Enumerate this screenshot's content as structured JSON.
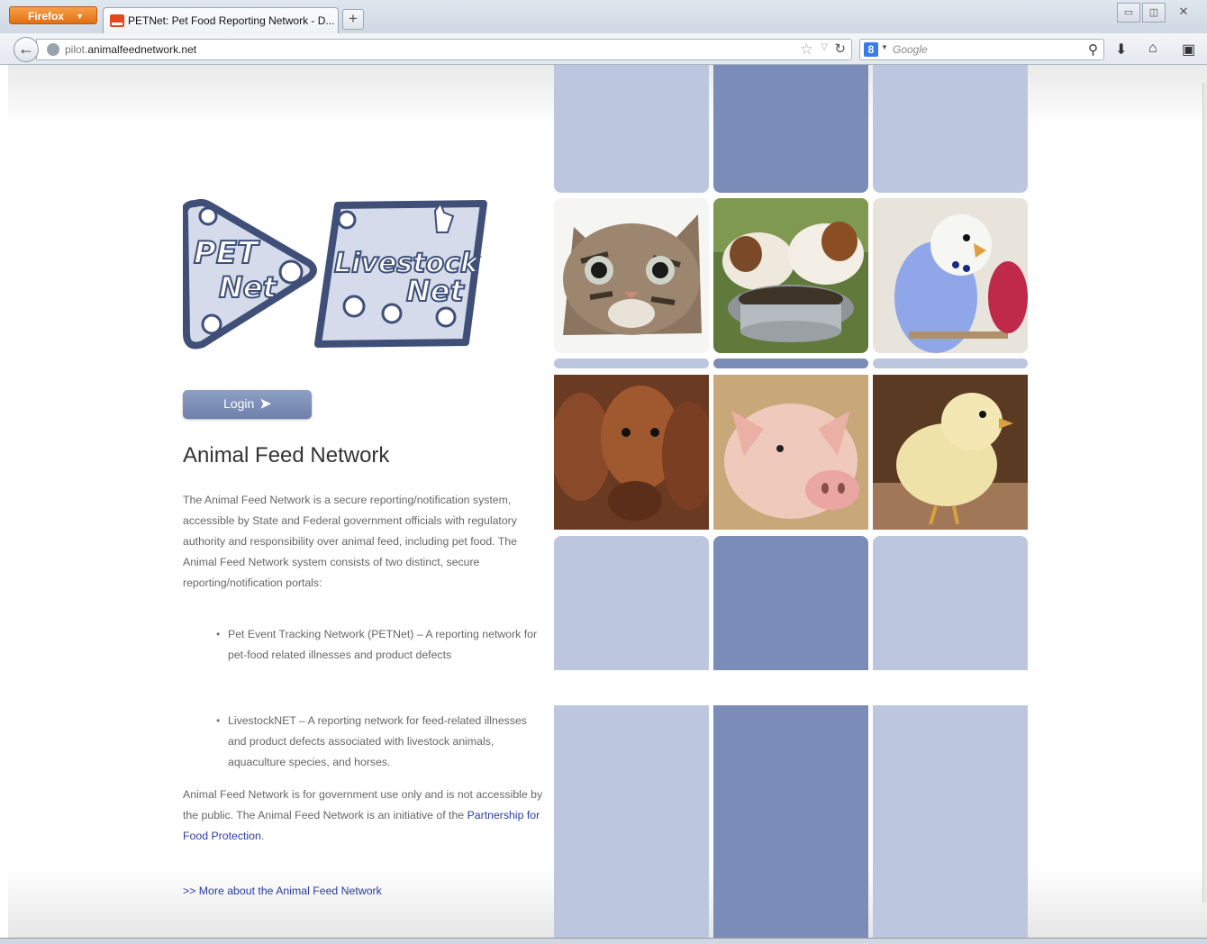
{
  "browser": {
    "menu_label": "Firefox",
    "tab_title": "PETNet: Pet Food Reporting Network - D...",
    "url_prefix": "pilot.",
    "url_domain": "animalfeednetwork.net",
    "search_placeholder": "Google"
  },
  "page": {
    "logo_left_line1": "PET",
    "logo_left_line2": "Net",
    "logo_right_line1": "Livestock",
    "logo_right_line2": "Net",
    "login_label": "Login",
    "heading": "Animal Feed Network",
    "intro": "The Animal Feed Network is a secure reporting/notification system, accessible by State and Federal government officials with regulatory authority and responsibility over animal feed, including pet food. The Animal Feed Network system consists of two distinct, secure reporting/notification portals:",
    "bullets": [
      "Pet Event Tracking Network (PETNet) – A reporting network for pet-food related illnesses and product defects",
      "LivestockNET – A reporting network for feed-related illnesses and product defects associated with livestock animals, aquaculture species, and horses."
    ],
    "footer_text_1": "Animal Feed Network is for government use only and is not accessible by the public.  The Animal Feed Network is an initiative of the ",
    "footer_link": "Partnership for Food Protection",
    "footer_text_2": ".",
    "more_link": ">> More about the Animal Feed Network"
  },
  "colors": {
    "tile_light": "#bcc7df",
    "tile_dark": "#7a8cb7",
    "logo_blue": "#3f4f78",
    "link": "#2b3b9e"
  },
  "photos": [
    "kitten",
    "puppies-eating",
    "budgie",
    "cows",
    "piglet",
    "chick"
  ]
}
